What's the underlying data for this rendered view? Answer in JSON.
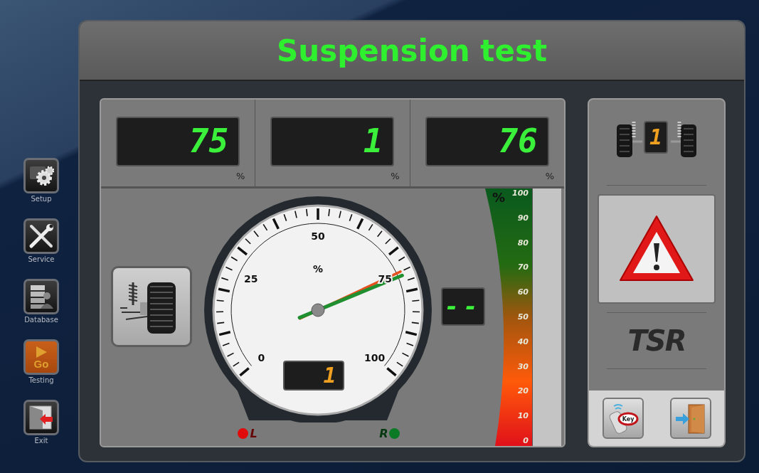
{
  "title": "Suspension test",
  "sidebar": {
    "items": [
      {
        "kind": "setup",
        "label": "Setup",
        "selected": false
      },
      {
        "kind": "service",
        "label": "Service",
        "selected": false
      },
      {
        "kind": "database",
        "label": "Database",
        "selected": false
      },
      {
        "kind": "testing",
        "label": "Testing",
        "icon_text": "Go",
        "selected": true
      },
      {
        "kind": "exit",
        "label": "Exit",
        "selected": false
      }
    ]
  },
  "readouts": [
    {
      "value": "75",
      "unit": "%"
    },
    {
      "value": "1",
      "unit": "%"
    },
    {
      "value": "76",
      "unit": "%"
    }
  ],
  "gauge": {
    "scale_labels": [
      "0",
      "25",
      "50",
      "75",
      "100"
    ],
    "unit": "%",
    "counter": "1",
    "needles": [
      {
        "level": 0.75,
        "color": "#e4501e"
      },
      {
        "level": 0.76,
        "color": "#1f8f30"
      }
    ]
  },
  "sides": [
    {
      "label": "L",
      "color": "#e00a0a"
    },
    {
      "label": "R",
      "color": "#0b7a25"
    }
  ],
  "side_display": "--",
  "scale": {
    "unit": "%",
    "labels": [
      "100",
      "90",
      "80",
      "70",
      "60",
      "50",
      "40",
      "30",
      "20",
      "10",
      "0"
    ]
  },
  "axle_counter": "1",
  "logo": "TSR",
  "bottom_buttons": [
    {
      "kind": "remote",
      "tag": "Key"
    },
    {
      "kind": "door"
    }
  ]
}
